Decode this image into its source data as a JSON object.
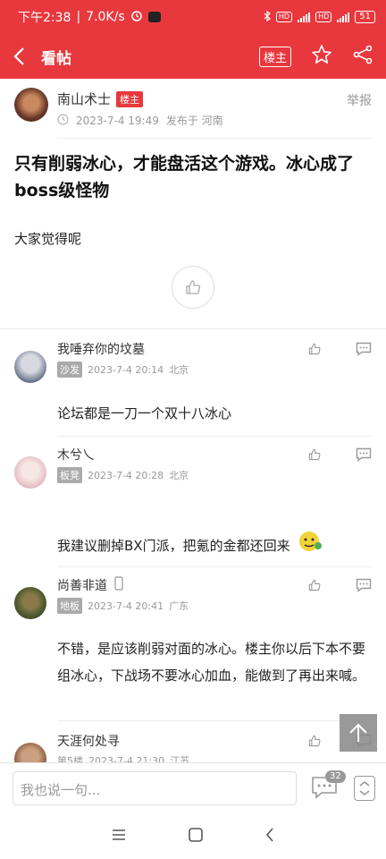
{
  "status_bar": {
    "time": "下午2:38",
    "speed": "7.0K/s",
    "battery": "51"
  },
  "nav": {
    "title": "看帖",
    "louzhu_button": "楼主"
  },
  "post": {
    "author": "南山术士",
    "author_tag": "楼主",
    "date": "2023-7-4 19:49",
    "location_label": "发布于 河南",
    "report": "举报",
    "title": "只有削弱冰心，才能盘活这个游戏。冰心成了boss级怪物",
    "body": "大家觉得呢"
  },
  "replies": [
    {
      "name": "我唾弃你的坟墓",
      "floor": "沙发",
      "date": "2023-7-4 20:14",
      "location": "北京",
      "text": "论坛都是一刀一个双十八冰心"
    },
    {
      "name": "木兮乀",
      "floor": "板凳",
      "date": "2023-7-4 20:28",
      "location": "北京",
      "text": "我建议删掉BX门派，把氪的金都还回来"
    },
    {
      "name": "尚善非道",
      "floor": "地板",
      "date": "2023-7-4 20:41",
      "location": "广东",
      "text": "不错，是应该削弱对面的冰心。楼主你以后下本不要组冰心，下战场不要冰心加血，能做到了再出来喊。"
    },
    {
      "name": "天涯何处寻",
      "floor": "第5楼",
      "date": "2023-7-4 21:30",
      "location": "江苏",
      "text": ""
    }
  ],
  "bottom": {
    "placeholder": "我也说一句...",
    "comment_count": "32"
  },
  "colors": {
    "brand": "#e8383d",
    "floor_badge": "#aaaaaa"
  }
}
